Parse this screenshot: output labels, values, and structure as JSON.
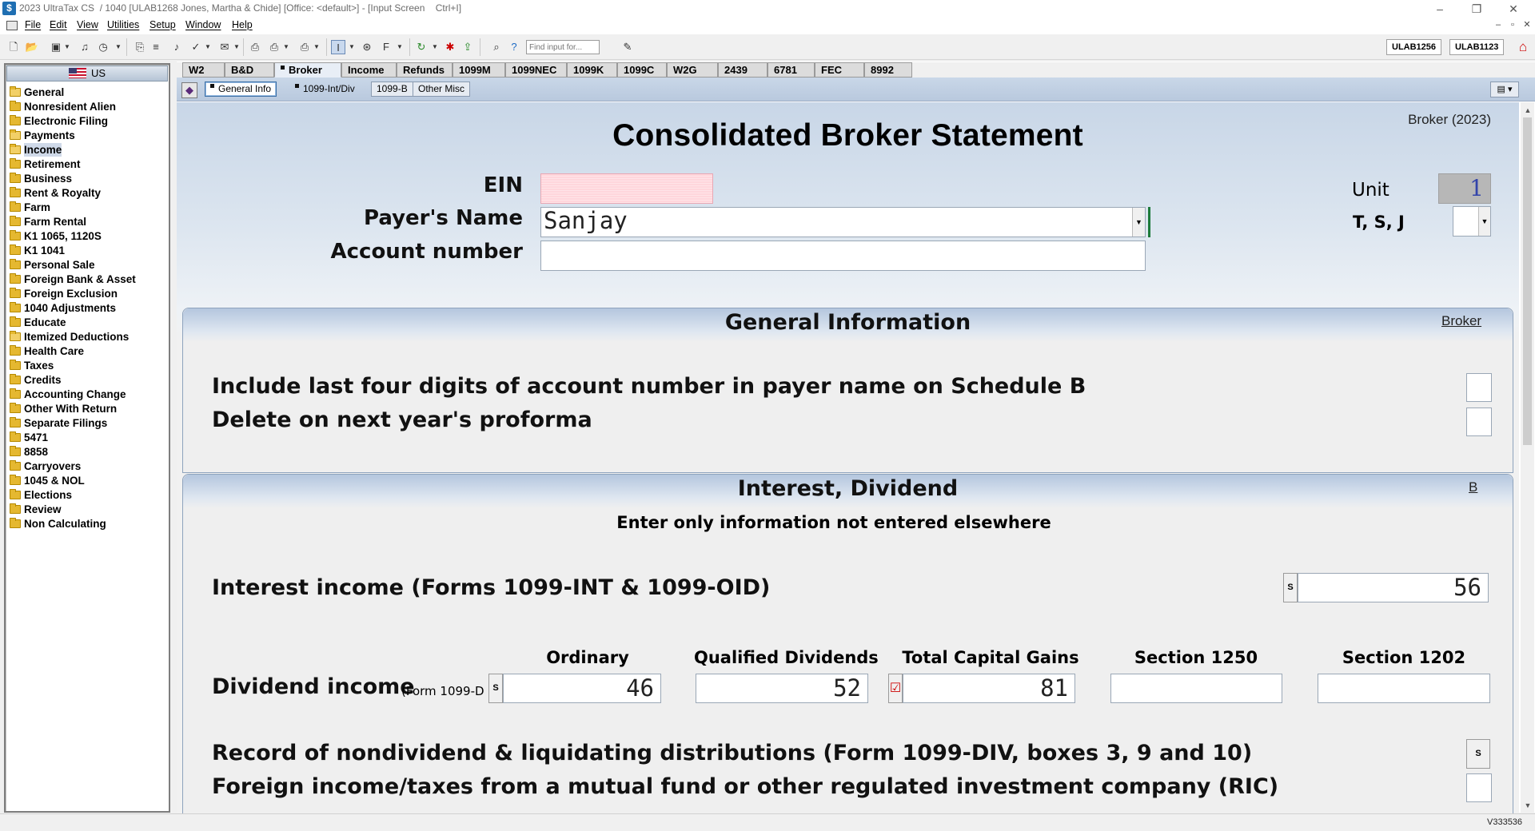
{
  "window": {
    "title": "2023 UltraTax CS  / 1040 [ULAB1268 Jones, Martha & Chide] [Office: <default>] - [Input Screen    Ctrl+I]",
    "app_icon": "$",
    "controls": [
      "–",
      "❐",
      "✕"
    ],
    "mdi_controls": [
      "–",
      "▫",
      "✕"
    ]
  },
  "menu": [
    "File",
    "Edit",
    "View",
    "Utilities",
    "Setup",
    "Window",
    "Help"
  ],
  "toolbar": {
    "find_placeholder": "Find input for...",
    "client_buttons": [
      "ULAB1256",
      "ULAB1123"
    ],
    "icons": [
      "new-icon",
      "open-icon",
      "save-icon",
      "audio-icon",
      "clock-icon",
      "copy-icon",
      "compare-icon",
      "music-icon",
      "check-icon",
      "email-icon",
      "print-icon",
      "print-preview-icon",
      "print-batch-icon",
      "input-icon",
      "globe-icon",
      "format-icon",
      "refresh-icon",
      "delete-icon",
      "export-icon",
      "search-icon",
      "help-icon",
      "form-icon",
      "alert-icon"
    ]
  },
  "tree": {
    "header": "US",
    "items": [
      "General",
      "Nonresident Alien",
      "Electronic Filing",
      "Payments",
      "Income",
      "Retirement",
      "Business",
      "Rent & Royalty",
      "Farm",
      "Farm Rental",
      "K1 1065, 1120S",
      "K1 1041",
      "Personal Sale",
      "Foreign Bank & Asset",
      "Foreign Exclusion",
      "1040 Adjustments",
      "Educate",
      "Itemized Deductions",
      "Health Care",
      "Taxes",
      "Credits",
      "Accounting Change",
      "Other With Return",
      "Separate Filings",
      "5471",
      "8858",
      "Carryovers",
      "1045 & NOL",
      "Elections",
      "Review",
      "Non Calculating"
    ],
    "selected": "Income"
  },
  "tabs": [
    "W2",
    "B&D",
    "Broker",
    "Income",
    "Refunds",
    "1099M",
    "1099NEC",
    "1099K",
    "1099C",
    "W2G",
    "2439",
    "6781",
    "FEC",
    "8992"
  ],
  "active_tab": "Broker",
  "subtabs": [
    "General Info",
    "1099-Int/Div",
    "1099-B",
    "Other Misc"
  ],
  "active_subtab": "General Info",
  "form": {
    "title": "Consolidated Broker Statement",
    "corner_label": "Broker (2023)",
    "ein_label": "EIN",
    "ein_value": "",
    "payer_label": "Payer's Name",
    "payer_value": "Sanjay",
    "account_label": "Account number",
    "account_value": "",
    "unit_label": "Unit",
    "unit_value": "1",
    "tsj_label": "T, S, J",
    "tsj_value": ""
  },
  "general_info": {
    "title": "General Information",
    "link": "Broker",
    "q1": "Include last four digits of account number in payer name on Schedule B",
    "q2": "Delete on next year's proforma"
  },
  "interest_dividend": {
    "title": "Interest, Dividend",
    "link": "B",
    "subtitle": "Enter only information not entered elsewhere",
    "interest_label": "Interest income (Forms 1099-INT & 1099-OID)",
    "interest_value": "56",
    "s_button": "S",
    "col_ordinary": "Ordinary",
    "col_qualified": "Qualified Dividends",
    "col_capital_gains": "Total Capital Gains",
    "col_1250": "Section 1250",
    "col_1202": "Section 1202",
    "dividend_label": "Dividend income",
    "dividend_sublabel": "(Form 1099-D",
    "ordinary_value": "46",
    "qualified_value": "52",
    "capital_gains_value": "81",
    "section_1250_value": "",
    "section_1202_value": "",
    "nondividend_label": "Record of nondividend & liquidating distributions (Form 1099-DIV, boxes 3, 9 and 10)",
    "foreign_label": "Foreign income/taxes from a mutual fund or other regulated investment company (RIC)"
  },
  "status": {
    "version": "V333536"
  }
}
